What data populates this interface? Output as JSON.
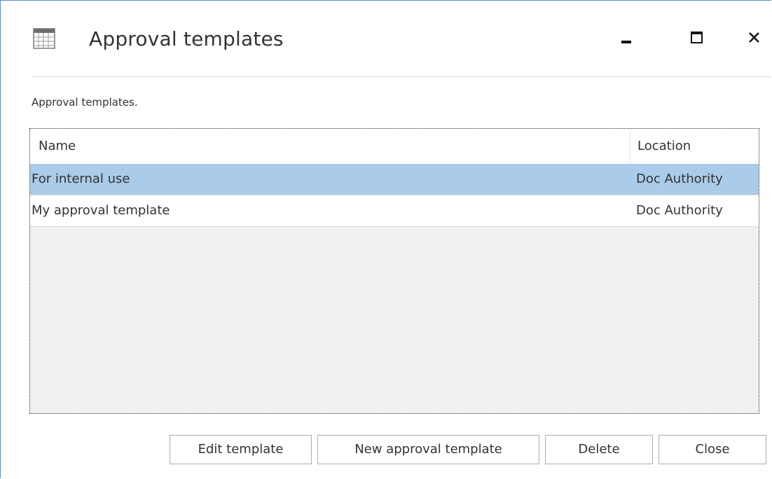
{
  "window": {
    "title": "Approval templates",
    "controls": {
      "minimize_icon": "minimize-icon",
      "maximize_icon": "maximize-icon",
      "close_icon": "close-icon"
    }
  },
  "description": "Approval templates.",
  "table": {
    "columns": [
      "Name",
      "Location"
    ],
    "rows": [
      {
        "name": "For internal use",
        "location": "Doc Authority",
        "selected": true
      },
      {
        "name": "My approval template",
        "location": "Doc Authority",
        "selected": false
      }
    ]
  },
  "buttons": {
    "edit": "Edit template",
    "new": "New approval template",
    "delete": "Delete",
    "close": "Close"
  },
  "colors": {
    "selection": "#aacbe9",
    "window_border": "#5b8fd4"
  }
}
